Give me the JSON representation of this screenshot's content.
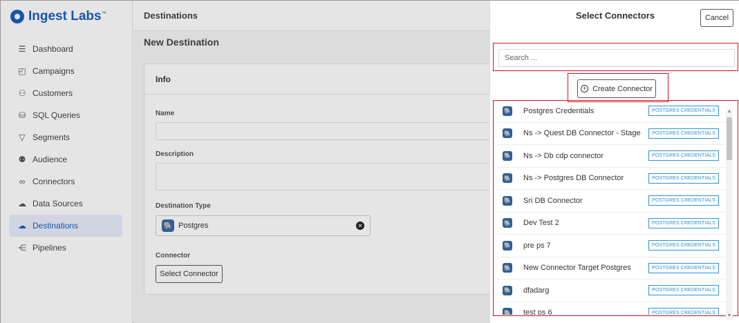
{
  "brand": {
    "name": "Ingest Labs",
    "mark": "™"
  },
  "sidebar": {
    "items": [
      {
        "label": "Dashboard",
        "icon": "list-icon"
      },
      {
        "label": "Campaigns",
        "icon": "megaphone-icon"
      },
      {
        "label": "Customers",
        "icon": "user-icon"
      },
      {
        "label": "SQL Queries",
        "icon": "database-icon"
      },
      {
        "label": "Segments",
        "icon": "filter-icon"
      },
      {
        "label": "Audience",
        "icon": "users-icon"
      },
      {
        "label": "Connectors",
        "icon": "link-icon"
      },
      {
        "label": "Data Sources",
        "icon": "cloud-download-icon"
      },
      {
        "label": "Destinations",
        "icon": "cloud-upload-icon",
        "active": true
      },
      {
        "label": "Pipelines",
        "icon": "share-icon"
      }
    ]
  },
  "main": {
    "breadcrumb": "Destinations",
    "page_title": "New Destination",
    "card_title": "Info",
    "name_label": "Name",
    "description_label": "Description",
    "destination_type_label": "Destination Type",
    "destination_type_value": "Postgres",
    "connector_label": "Connector",
    "select_connector_label": "Select Connector"
  },
  "panel": {
    "title": "Select Connectors",
    "cancel_label": "Cancel",
    "search_placeholder": "Search ...",
    "create_label": "Create Connector",
    "connectors": [
      {
        "name": "Postgres Credentials",
        "badge": "POSTGRES CREDENTIALS"
      },
      {
        "name": "Ns -> Quest DB Connector - Stage",
        "badge": "POSTGRES CREDENTIALS"
      },
      {
        "name": "Ns -> Db cdp connector",
        "badge": "POSTGRES CREDENTIALS"
      },
      {
        "name": "Ns -> Postgres DB Connector",
        "badge": "POSTGRES CREDENTIALS"
      },
      {
        "name": "Sri DB Connector",
        "badge": "POSTGRES CREDENTIALS"
      },
      {
        "name": "Dev Test 2",
        "badge": "POSTGRES CREDENTIALS"
      },
      {
        "name": "pre ps 7",
        "badge": "POSTGRES CREDENTIALS"
      },
      {
        "name": "New Connector Target Postgres",
        "badge": "POSTGRES CREDENTIALS"
      },
      {
        "name": "dfadarg",
        "badge": "POSTGRES CREDENTIALS"
      },
      {
        "name": "test ps 6",
        "badge": "POSTGRES CREDENTIALS"
      }
    ]
  },
  "colors": {
    "brand": "#1b5fbf",
    "highlight": "#d0101f",
    "badge": "#2e8fd6"
  }
}
